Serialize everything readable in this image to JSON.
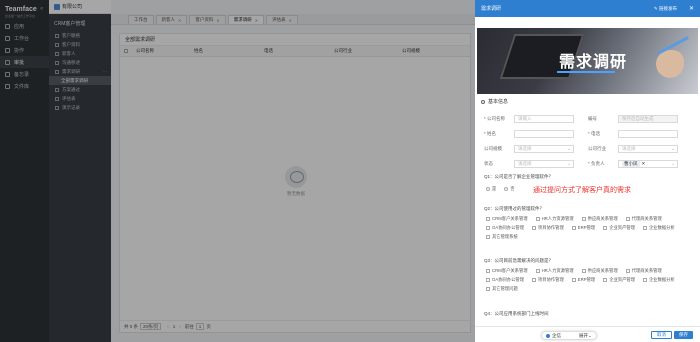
{
  "nav": {
    "brand": "Teamface",
    "brand_sub": "企业级一站式工作平台",
    "items": [
      {
        "label": "应用"
      },
      {
        "label": "工作台"
      },
      {
        "label": "协作"
      },
      {
        "label": "审批"
      },
      {
        "label": "备忘录"
      },
      {
        "label": "文件库"
      }
    ]
  },
  "sidebar": {
    "company": "有限公司",
    "title": "CRM客户管理",
    "items": [
      {
        "label": "客户联络"
      },
      {
        "label": "客户资料"
      },
      {
        "label": "新客人"
      },
      {
        "label": "沟通移述"
      },
      {
        "label": "需求调研"
      }
    ],
    "subitems": [
      {
        "label": "全部需求调研"
      },
      {
        "label": "方案通过"
      },
      {
        "label": "评估表"
      },
      {
        "label": "演示记录"
      }
    ]
  },
  "tabs": [
    {
      "label": "工作台"
    },
    {
      "label": "新客人"
    },
    {
      "label": "客户资料"
    },
    {
      "label": "需求调研"
    },
    {
      "label": "评估表"
    }
  ],
  "panel": {
    "title": "全部需求调研",
    "columns": [
      "公司名称",
      "姓名",
      "电话",
      "公司行业",
      "公司规模"
    ],
    "empty_text": "暂无数据",
    "pager": {
      "total": "共 0 条",
      "per_page": "20条/页",
      "goto_label": "前往",
      "page": "1",
      "page_unit": "页"
    }
  },
  "drawer": {
    "title": "需求调研",
    "share": "链接发布",
    "banner_title": "需求调研",
    "section": "基本信息",
    "fields": {
      "company_name": {
        "label": "* 公司名称",
        "placeholder": "请输入"
      },
      "number": {
        "label": "编号",
        "placeholder": "保存后自动生成"
      },
      "name": {
        "label": "* 姓名"
      },
      "phone": {
        "label": "* 电话"
      },
      "scale": {
        "label": "公司规模",
        "placeholder": "请选择"
      },
      "industry": {
        "label": "公司行业",
        "placeholder": "请选择"
      },
      "status": {
        "label": "状态",
        "placeholder": "请选择"
      },
      "owner": {
        "label": "* 负责人",
        "value": "曹小凤"
      }
    },
    "q1": {
      "text": "Q1：公司是否了解企业管理软件？",
      "options": [
        "是",
        "否"
      ]
    },
    "annotation": "通过提问方式了解客户真的需求",
    "q2": {
      "text": "Q2：公司使用过的管理软件？",
      "options": [
        "CRM客户关系管理",
        "HR人力资源管理",
        "供应商关系管理",
        "代理商关系管理",
        "OA协同办公管理",
        "项目协作管理",
        "ERP管理",
        "企业资产管理",
        "企业数据分析",
        "其它管理系统"
      ]
    },
    "q3": {
      "text": "Q3：公司目前急需解决的问题是？",
      "options": [
        "CRM客户关系管理",
        "HR人力资源管理",
        "供应商关系管理",
        "代理商关系管理",
        "OA协同办公管理",
        "项目协作管理",
        "ERP管理",
        "企业资产管理",
        "企业数据分析",
        "其它管理问题"
      ]
    },
    "q4": {
      "text": "Q4：公司应用系统部门上线时间"
    },
    "footer": {
      "bubble_label": "企信",
      "bubble_action": "展开",
      "cancel": "取消",
      "save": "保存"
    }
  }
}
